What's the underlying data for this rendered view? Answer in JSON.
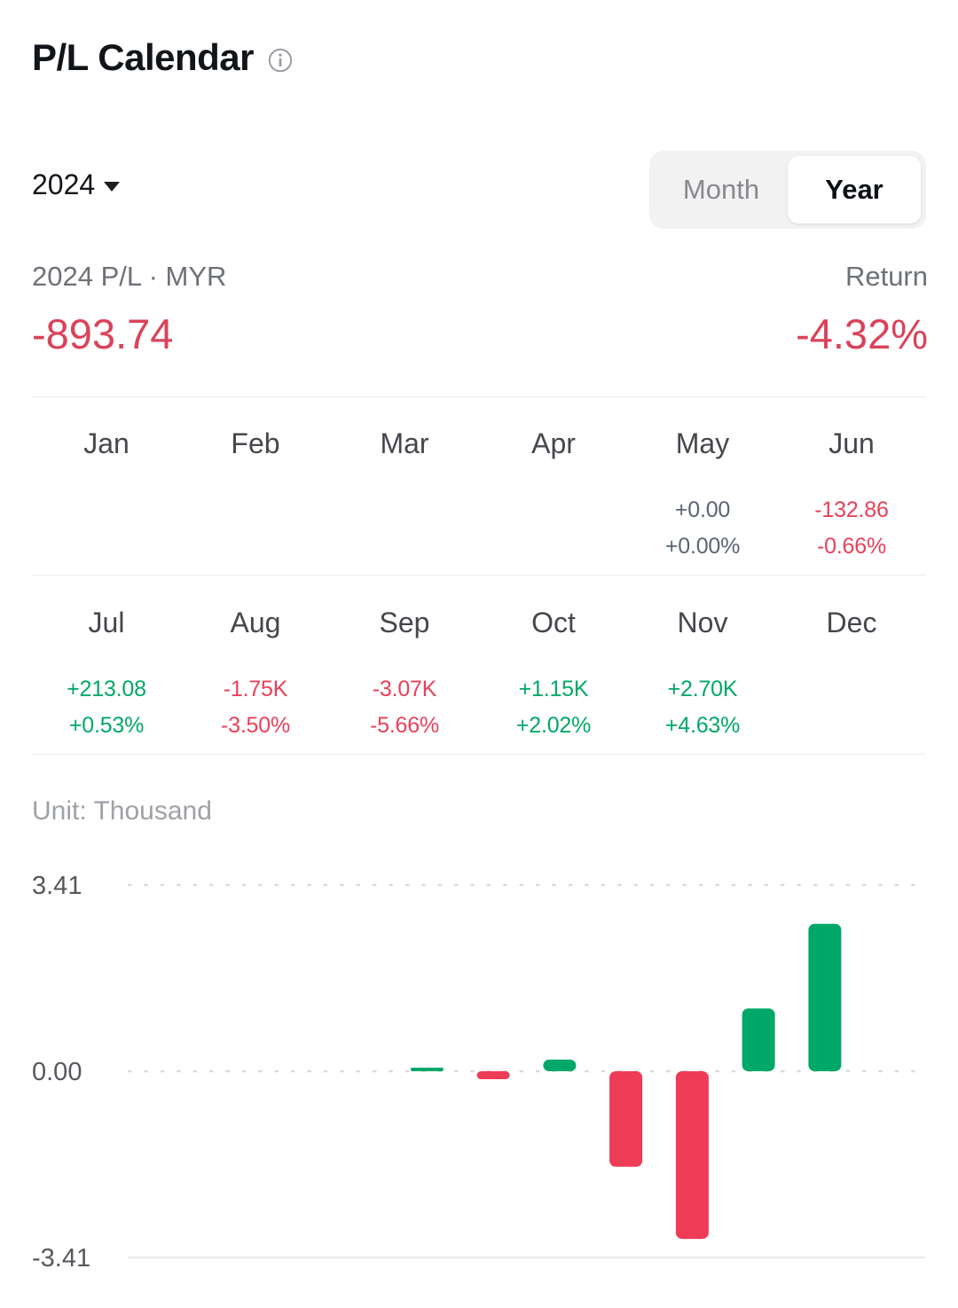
{
  "header": {
    "title": "P/L Calendar",
    "info_icon": "info-circle-icon"
  },
  "controls": {
    "year": "2024",
    "caret_icon": "chevron-down-icon",
    "period_options": [
      "Month",
      "Year"
    ],
    "period_month_label": "Month",
    "period_year_label": "Year",
    "period_selected": "Year"
  },
  "summary": {
    "pl_caption": "2024 P/L · MYR",
    "pl_value": "-893.74",
    "return_caption": "Return",
    "return_value": "-4.32%"
  },
  "months": [
    {
      "name": "Jan",
      "amount": "",
      "percent": "",
      "state": "empty"
    },
    {
      "name": "Feb",
      "amount": "",
      "percent": "",
      "state": "empty"
    },
    {
      "name": "Mar",
      "amount": "",
      "percent": "",
      "state": "empty"
    },
    {
      "name": "Apr",
      "amount": "",
      "percent": "",
      "state": "empty"
    },
    {
      "name": "May",
      "amount": "+0.00",
      "percent": "+0.00%",
      "state": "flat"
    },
    {
      "name": "Jun",
      "amount": "-132.86",
      "percent": "-0.66%",
      "state": "neg"
    },
    {
      "name": "Jul",
      "amount": "+213.08",
      "percent": "+0.53%",
      "state": "pos"
    },
    {
      "name": "Aug",
      "amount": "-1.75K",
      "percent": "-3.50%",
      "state": "neg"
    },
    {
      "name": "Sep",
      "amount": "-3.07K",
      "percent": "-5.66%",
      "state": "neg"
    },
    {
      "name": "Oct",
      "amount": "+1.15K",
      "percent": "+2.02%",
      "state": "pos"
    },
    {
      "name": "Nov",
      "amount": "+2.70K",
      "percent": "+4.63%",
      "state": "pos"
    },
    {
      "name": "Dec",
      "amount": "",
      "percent": "",
      "state": "empty"
    }
  ],
  "chart_unit_label": "Unit: Thousand",
  "colors": {
    "positive": "#00a868",
    "negative": "#e8415a",
    "flat": "#5a6573",
    "summary_negative": "#d9435a",
    "gridline": "#d9dadd",
    "axis_line": "#e7e8ea"
  },
  "chart_data": {
    "type": "bar",
    "title": "",
    "subtitle": "Unit: Thousand",
    "xlabel": "",
    "ylabel": "",
    "unit": "Thousand",
    "categories": [
      "Jan",
      "Feb",
      "Mar",
      "Apr",
      "May",
      "Jun",
      "Jul",
      "Aug",
      "Sep",
      "Oct",
      "Nov",
      "Dec"
    ],
    "values": [
      null,
      null,
      null,
      null,
      0.0,
      -0.13286,
      0.21308,
      -1.75,
      -3.07,
      1.15,
      2.7,
      null
    ],
    "ylim": [
      -3.41,
      3.41
    ],
    "yticks": [
      3.41,
      0.0,
      -3.41
    ],
    "ytick_labels": [
      "3.41",
      "0.00",
      "-3.41"
    ],
    "grid": true,
    "gridline_style": "dotted",
    "legend": "none",
    "bar_colors": {
      "positive": "#00a868",
      "negative": "#ee3b56"
    }
  }
}
